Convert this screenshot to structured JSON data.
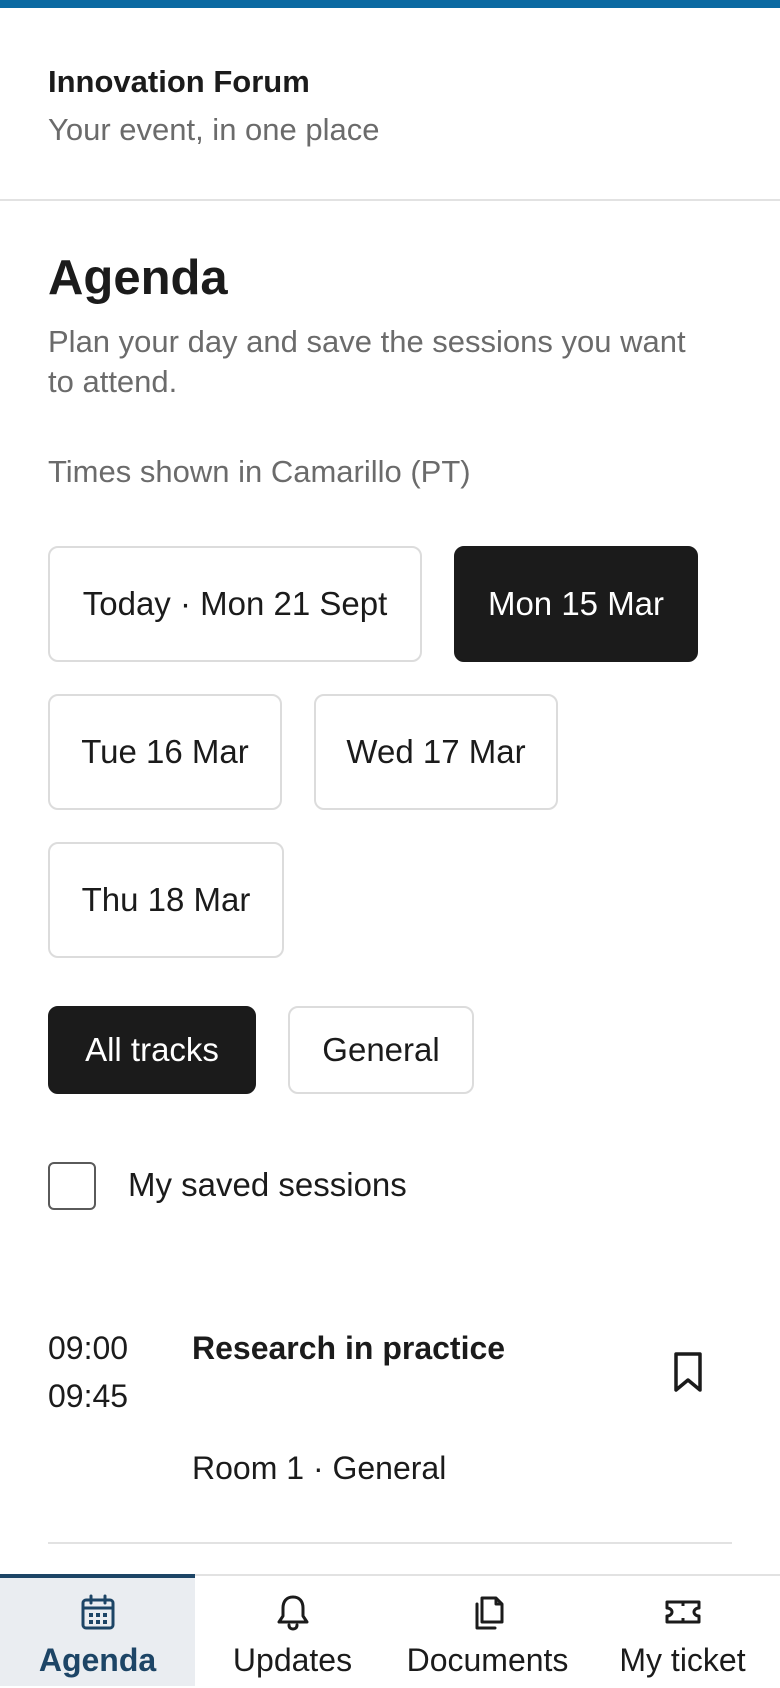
{
  "app": {
    "title": "Innovation Forum",
    "subtitle": "Your event, in one place"
  },
  "agenda": {
    "title": "Agenda",
    "description": "Plan your day and save the sessions you want to attend.",
    "timezone_note": "Times shown in Camarillo (PT)"
  },
  "days": [
    {
      "label": "Today · Mon 21 Sept",
      "selected": false
    },
    {
      "label": "Mon 15 Mar",
      "selected": true
    },
    {
      "label": "Tue 16 Mar",
      "selected": false
    },
    {
      "label": "Wed 17 Mar",
      "selected": false
    },
    {
      "label": "Thu 18 Mar",
      "selected": false
    }
  ],
  "tracks": [
    {
      "label": "All tracks",
      "selected": true
    },
    {
      "label": "General",
      "selected": false
    }
  ],
  "saved_filter": {
    "label": "My saved sessions",
    "checked": false
  },
  "sessions": [
    {
      "start": "09:00",
      "end": "09:45",
      "title": "Research in practice",
      "meta": "Room 1 · General",
      "bookmarked": false
    }
  ],
  "tabbar": {
    "items": [
      {
        "label": "Agenda",
        "icon": "calendar-icon",
        "active": true
      },
      {
        "label": "Updates",
        "icon": "bell-icon",
        "active": false
      },
      {
        "label": "Documents",
        "icon": "documents-icon",
        "active": false
      },
      {
        "label": "My ticket",
        "icon": "ticket-icon",
        "active": false
      }
    ]
  },
  "colors": {
    "accent_bar": "#0b6aa2",
    "selected_chip": "#1b1b1b",
    "active_tab": "#1d4566",
    "active_tab_bg": "#eaedf1"
  }
}
